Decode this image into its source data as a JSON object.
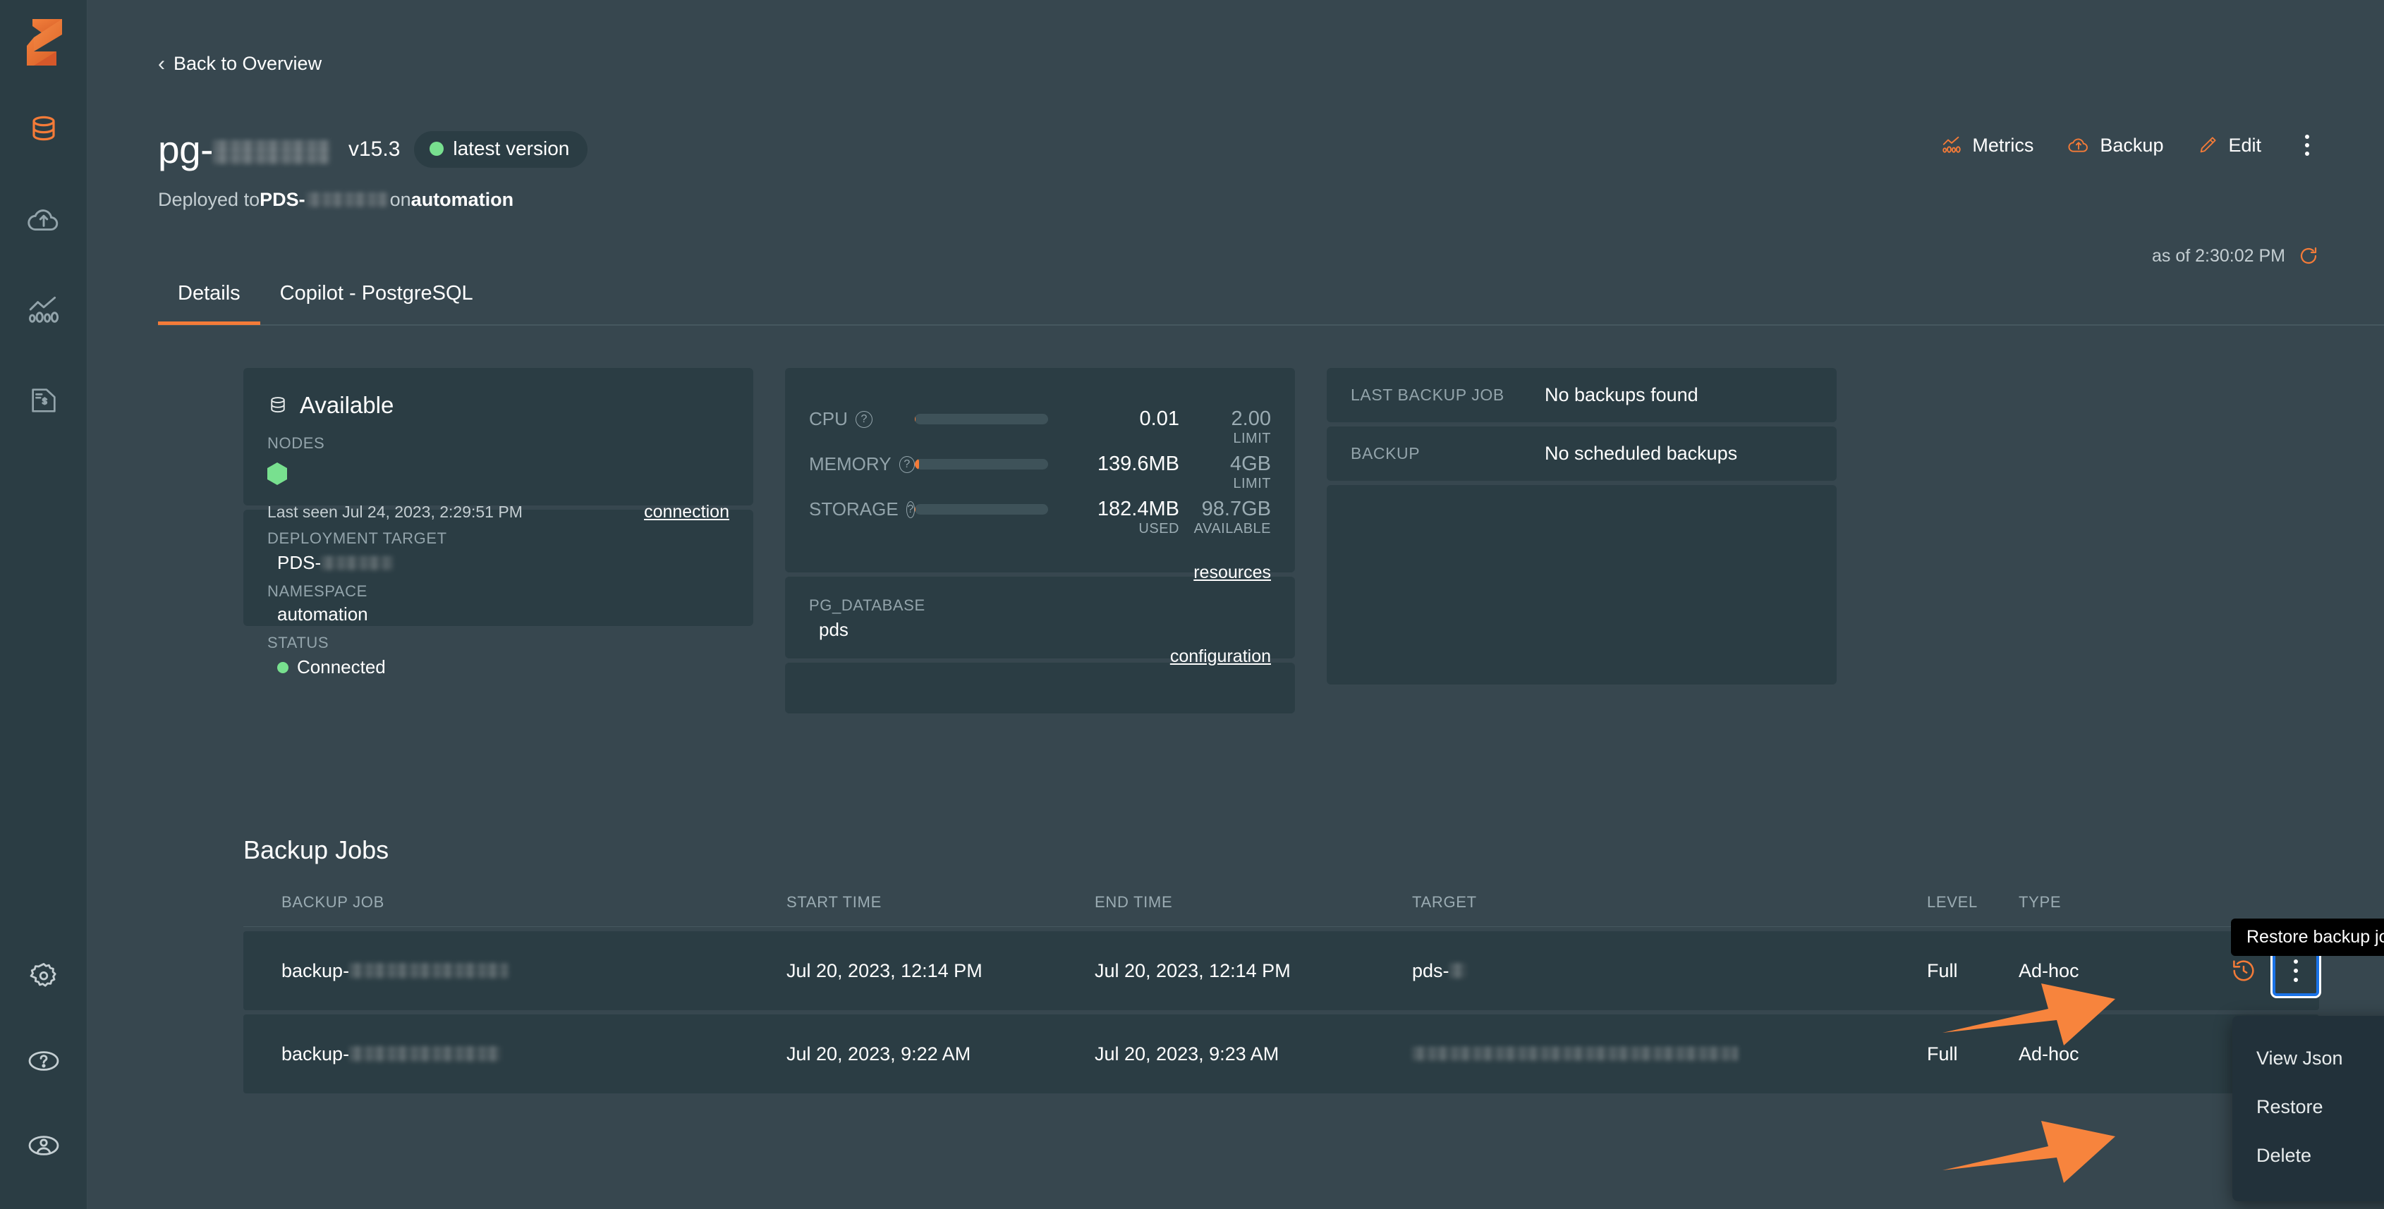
{
  "sidebar": {
    "logo_name": "portworx-logo",
    "items": [
      {
        "icon": "database-icon",
        "name": "sidebar-item-databases",
        "active": true
      },
      {
        "icon": "cloud-upload-icon",
        "name": "sidebar-item-backups",
        "active": false
      },
      {
        "icon": "chart-line-icon",
        "name": "sidebar-item-metrics",
        "active": false
      },
      {
        "icon": "invoice-dollar-icon",
        "name": "sidebar-item-billing",
        "active": false
      }
    ],
    "bottom_items": [
      {
        "icon": "gear-icon",
        "name": "sidebar-item-settings"
      },
      {
        "icon": "help-circle-icon",
        "name": "sidebar-item-help"
      },
      {
        "icon": "user-circle-icon",
        "name": "sidebar-item-account"
      }
    ]
  },
  "header": {
    "back_link": "Back to Overview",
    "title_prefix": "pg-",
    "title_redacted_width": 165,
    "version": "v15.3",
    "badge_label": "latest version",
    "badge_dot_color": "#78e08f",
    "subtitle_prefix": "Deployed to ",
    "subtitle_target_prefix": "PDS-",
    "subtitle_mid": " on ",
    "subtitle_namespace": "automation",
    "as_of": "as of 2:30:02 PM",
    "refresh_icon": "refresh-icon"
  },
  "actions": [
    {
      "label": "Metrics",
      "icon": "chart-line-icon",
      "name": "metrics-button"
    },
    {
      "label": "Backup",
      "icon": "cloud-upload-icon",
      "name": "backup-button"
    },
    {
      "label": "Edit",
      "icon": "pencil-icon",
      "name": "edit-button"
    }
  ],
  "tabs": [
    {
      "label": "Details",
      "active": true
    },
    {
      "label": "Copilot - PostgreSQL",
      "active": false
    }
  ],
  "status_card": {
    "header": "Available",
    "header_icon": "database-icon",
    "nodes_label": "NODES",
    "node_status_color": "#78e08f",
    "last_seen": "Last seen Jul 24, 2023, 2:29:51 PM",
    "connection_link": "connection",
    "deployment_target_label": "DEPLOYMENT TARGET",
    "deployment_target_prefix": "PDS-",
    "namespace_label": "NAMESPACE",
    "namespace_value": "automation",
    "status_label": "STATUS",
    "status_value": "Connected",
    "status_dot_color": "#78e08f"
  },
  "resources_card": {
    "metrics": [
      {
        "name": "CPU",
        "bar_pct": 0.5,
        "used": "0.01",
        "limit": "2.00",
        "limit_sub": "LIMIT",
        "used_sub": ""
      },
      {
        "name": "MEMORY",
        "bar_pct": 3.4,
        "used": "139.6MB",
        "limit": "4GB",
        "limit_sub": "LIMIT",
        "used_sub": ""
      },
      {
        "name": "STORAGE",
        "bar_pct": 0.2,
        "used": "182.4MB",
        "limit": "98.7GB",
        "limit_sub": "AVAILABLE",
        "used_sub": "USED"
      }
    ],
    "resources_link": "resources",
    "db_label": "PG_DATABASE",
    "db_value": "pds",
    "configuration_link": "configuration"
  },
  "backup_card": {
    "rows": [
      {
        "label": "LAST BACKUP JOB",
        "value": "No backups found"
      },
      {
        "label": "BACKUP",
        "value": "No scheduled backups"
      }
    ]
  },
  "backup_jobs": {
    "section_title": "Backup Jobs",
    "columns": [
      "BACKUP JOB",
      "START TIME",
      "END TIME",
      "TARGET",
      "LEVEL",
      "TYPE"
    ],
    "rows": [
      {
        "status_color": "#78e08f",
        "job_prefix": "backup-",
        "job_redacted_width": 226,
        "start_time": "Jul 20, 2023, 12:14 PM",
        "end_time": "Jul 20, 2023, 12:14 PM",
        "target_prefix": "pds-",
        "target_redacted_width": 24,
        "target_fully_redacted": false,
        "level": "Full",
        "type": "Ad-hoc",
        "has_restore_icon": true,
        "has_kebab": true,
        "kebab_focused": true
      },
      {
        "status_color": "#78e08f",
        "job_prefix": "backup-",
        "job_redacted_width": 215,
        "start_time": "Jul 20, 2023, 9:22 AM",
        "end_time": "Jul 20, 2023, 9:23 AM",
        "target_prefix": "",
        "target_redacted_width": 460,
        "target_fully_redacted": true,
        "level": "Full",
        "type": "Ad-hoc",
        "has_restore_icon": false,
        "has_kebab": false,
        "kebab_focused": false
      }
    ]
  },
  "tooltip": {
    "text": "Restore backup job"
  },
  "dropdown": {
    "items": [
      "View Json",
      "Restore",
      "Delete"
    ]
  },
  "colors": {
    "accent": "#f47b38",
    "page_bg": "#37474f",
    "card_bg": "#2b3d44",
    "menu_bg": "#22313a",
    "focus_blue": "#1a73e8",
    "green": "#78e08f",
    "muted_text": "#93a4ab"
  }
}
